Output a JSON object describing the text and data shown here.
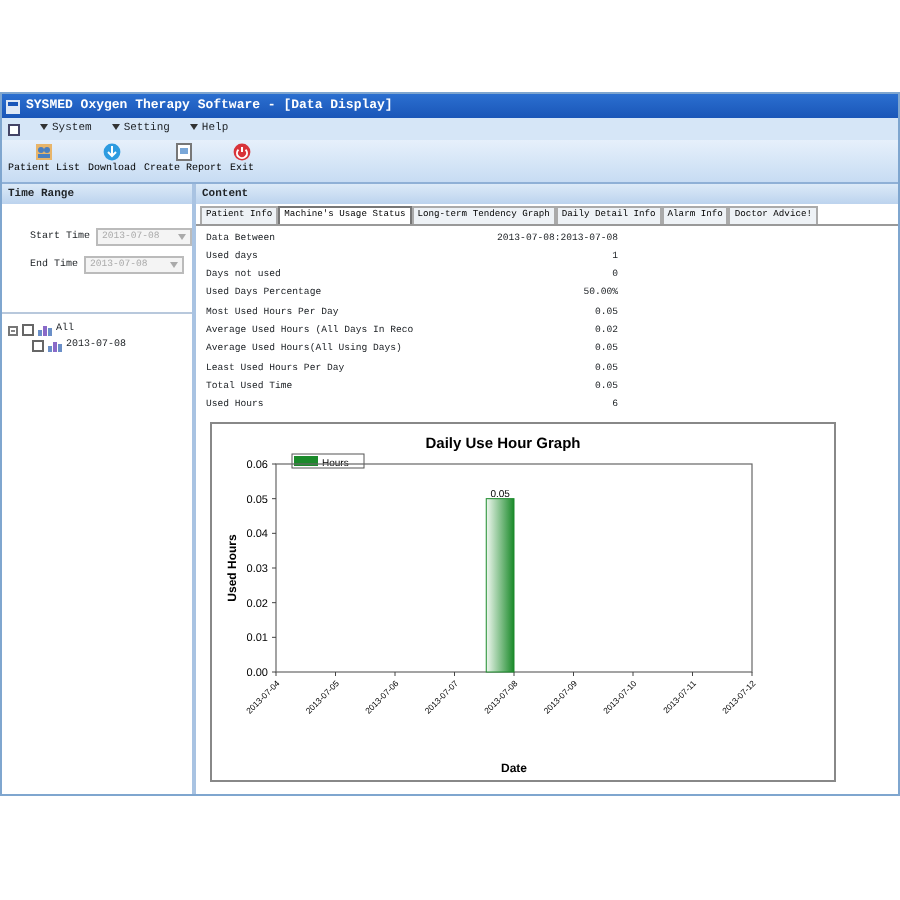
{
  "window": {
    "title": "SYSMED Oxygen Therapy Software - [Data Display]"
  },
  "menu": [
    {
      "label": "System"
    },
    {
      "label": "Setting"
    },
    {
      "label": "Help"
    }
  ],
  "toolbar": [
    {
      "label": "Patient List",
      "kind": "patients"
    },
    {
      "label": "Download",
      "kind": "download"
    },
    {
      "label": "Create Report",
      "kind": "report"
    },
    {
      "label": "Exit",
      "kind": "exit"
    }
  ],
  "time_range": {
    "title": "Time Range",
    "fields": [
      {
        "label": "Start Time",
        "value": "2013-07-08",
        "disabled": true
      },
      {
        "label": "End Time",
        "value": "2013-07-08",
        "disabled": true
      }
    ],
    "tree": [
      {
        "label": "All",
        "expanded": true,
        "checked": false,
        "children": [
          {
            "label": "2013-07-08",
            "checked": false
          }
        ]
      }
    ]
  },
  "content": {
    "title": "Content",
    "tabs": [
      {
        "label": "Patient Info",
        "selected": false
      },
      {
        "label": "Machine's Usage Status",
        "selected": true
      },
      {
        "label": "Long-term Tendency Graph",
        "selected": false
      },
      {
        "label": "Daily Detail Info",
        "selected": false
      },
      {
        "label": "Alarm Info",
        "selected": false
      },
      {
        "label": "Doctor Advice!",
        "selected": false
      }
    ],
    "rows": [
      {
        "label": "Data Between",
        "value": "2013-07-08:2013-07-08"
      },
      {
        "label": "Used days",
        "value": "1"
      },
      {
        "label": "Days not used",
        "value": "0"
      },
      {
        "label": "Used Days Percentage",
        "value": "50.00%"
      },
      {
        "label": "Most Used Hours Per Day",
        "value": "0.05"
      },
      {
        "label": "Average Used Hours (All Days In Reco",
        "value": "0.02"
      },
      {
        "label": "Average Used Hours(All Using Days)",
        "value": "0.05"
      },
      {
        "label": "Least Used Hours Per Day",
        "value": "0.05"
      },
      {
        "label": "Total Used Time",
        "value": "0.05"
      },
      {
        "label": "Used Hours",
        "value": "6"
      }
    ],
    "chart_data": {
      "type": "bar",
      "title": "Daily Use Hour Graph",
      "xlabel": "Date",
      "ylabel": "Used Hours",
      "categories": [
        "2013-07-04",
        "2013-07-05",
        "2013-07-06",
        "2013-07-07",
        "2013-07-08",
        "2013-07-09",
        "2013-07-10",
        "2013-07-11",
        "2013-07-12"
      ],
      "series": [
        {
          "name": "Hours",
          "color": "#1a8a2a",
          "values": [
            null,
            null,
            null,
            null,
            0.05,
            null,
            null,
            null,
            null
          ]
        }
      ],
      "ylim": [
        0,
        0.06
      ],
      "yticks": [
        {
          "value": 0,
          "label": "0.00"
        },
        {
          "value": 0.01,
          "label": "0.01"
        },
        {
          "value": 0.02,
          "label": "0.02"
        },
        {
          "value": 0.03,
          "label": "0.03"
        },
        {
          "value": 0.04,
          "label": "0.04"
        },
        {
          "value": 0.05,
          "label": "0.05"
        },
        {
          "value": 0.06,
          "label": "0.06"
        }
      ],
      "data_labels": true
    }
  }
}
